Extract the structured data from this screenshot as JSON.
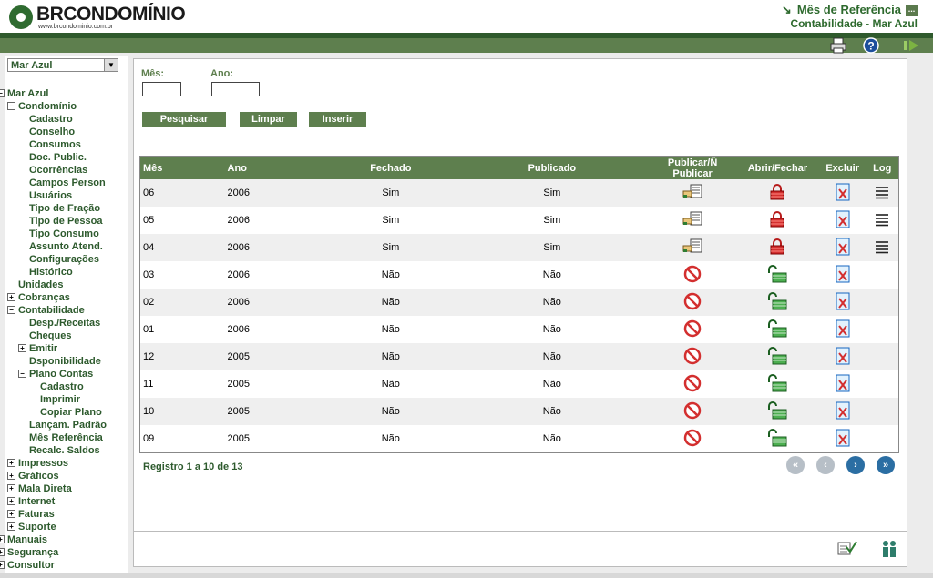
{
  "header": {
    "brand": "BRCONDOMÍNIO",
    "brand_url": "www.brcondominio.com.br",
    "page_title": "Mês de Referência",
    "page_subtitle": "Contabilidade - Mar Azul",
    "title_arrow": "↘",
    "dots": "..."
  },
  "toolbar": {
    "icons": [
      "print-icon",
      "help-icon",
      "exit-icon"
    ]
  },
  "sidebar": {
    "selected_unit": "Mar Azul",
    "tree": [
      {
        "label": "Mar Azul",
        "level": 0,
        "toggle": "−"
      },
      {
        "label": "Condomínio",
        "level": 1,
        "toggle": "−"
      },
      {
        "label": "Cadastro",
        "level": 2,
        "toggle": ""
      },
      {
        "label": "Conselho",
        "level": 2,
        "toggle": ""
      },
      {
        "label": "Consumos",
        "level": 2,
        "toggle": ""
      },
      {
        "label": "Doc. Public.",
        "level": 2,
        "toggle": ""
      },
      {
        "label": "Ocorrências",
        "level": 2,
        "toggle": ""
      },
      {
        "label": "Campos Person",
        "level": 2,
        "toggle": ""
      },
      {
        "label": "Usuários",
        "level": 2,
        "toggle": ""
      },
      {
        "label": "Tipo de Fração",
        "level": 2,
        "toggle": ""
      },
      {
        "label": "Tipo de Pessoa",
        "level": 2,
        "toggle": ""
      },
      {
        "label": "Tipo Consumo",
        "level": 2,
        "toggle": ""
      },
      {
        "label": "Assunto Atend.",
        "level": 2,
        "toggle": ""
      },
      {
        "label": "Configurações",
        "level": 2,
        "toggle": ""
      },
      {
        "label": "Histórico",
        "level": 2,
        "toggle": ""
      },
      {
        "label": "Unidades",
        "level": 1,
        "toggle": ""
      },
      {
        "label": "Cobranças",
        "level": 1,
        "toggle": "+"
      },
      {
        "label": "Contabilidade",
        "level": 1,
        "toggle": "−"
      },
      {
        "label": "Desp./Receitas",
        "level": 2,
        "toggle": ""
      },
      {
        "label": "Cheques",
        "level": 2,
        "toggle": ""
      },
      {
        "label": "Emitir",
        "level": 2,
        "toggle": "+"
      },
      {
        "label": "Dsponibilidade",
        "level": 2,
        "toggle": ""
      },
      {
        "label": "Plano Contas",
        "level": 2,
        "toggle": "−"
      },
      {
        "label": "Cadastro",
        "level": 3,
        "toggle": ""
      },
      {
        "label": "Imprimir",
        "level": 3,
        "toggle": ""
      },
      {
        "label": "Copiar Plano",
        "level": 3,
        "toggle": ""
      },
      {
        "label": "Lançam. Padrão",
        "level": 2,
        "toggle": ""
      },
      {
        "label": "Mês Referência",
        "level": 2,
        "toggle": ""
      },
      {
        "label": "Recalc. Saldos",
        "level": 2,
        "toggle": ""
      },
      {
        "label": "Impressos",
        "level": 1,
        "toggle": "+"
      },
      {
        "label": "Gráficos",
        "level": 1,
        "toggle": "+"
      },
      {
        "label": "Mala Direta",
        "level": 1,
        "toggle": "+"
      },
      {
        "label": "Internet",
        "level": 1,
        "toggle": "+"
      },
      {
        "label": "Faturas",
        "level": 1,
        "toggle": "+"
      },
      {
        "label": "Suporte",
        "level": 1,
        "toggle": "+"
      },
      {
        "label": "Manuais",
        "level": 0,
        "toggle": "+"
      },
      {
        "label": "Segurança",
        "level": 0,
        "toggle": "+"
      },
      {
        "label": "Consultor",
        "level": 0,
        "toggle": "+"
      }
    ]
  },
  "form": {
    "mes_label": "Mês:",
    "ano_label": "Ano:",
    "mes_value": "",
    "ano_value": "",
    "buttons": {
      "search": "Pesquisar",
      "clear": "Limpar",
      "insert": "Inserir"
    }
  },
  "table": {
    "headers": [
      "Mês",
      "Ano",
      "Fechado",
      "Publicado",
      "Publicar/Ñ Publicar",
      "Abrir/Fechar",
      "Excluir",
      "Log"
    ],
    "rows": [
      {
        "mes": "06",
        "ano": "2006",
        "fechado": "Sim",
        "publicado": "Sim",
        "pub_icon": "publish-hand-icon",
        "lock_icon": "closed-lock-icon",
        "log": true
      },
      {
        "mes": "05",
        "ano": "2006",
        "fechado": "Sim",
        "publicado": "Sim",
        "pub_icon": "publish-hand-icon",
        "lock_icon": "closed-lock-icon",
        "log": true
      },
      {
        "mes": "04",
        "ano": "2006",
        "fechado": "Sim",
        "publicado": "Sim",
        "pub_icon": "publish-hand-icon",
        "lock_icon": "closed-lock-icon",
        "log": true
      },
      {
        "mes": "03",
        "ano": "2006",
        "fechado": "Não",
        "publicado": "Não",
        "pub_icon": "no-entry-icon",
        "lock_icon": "open-lock-icon",
        "log": false
      },
      {
        "mes": "02",
        "ano": "2006",
        "fechado": "Não",
        "publicado": "Não",
        "pub_icon": "no-entry-icon",
        "lock_icon": "open-lock-icon",
        "log": false
      },
      {
        "mes": "01",
        "ano": "2006",
        "fechado": "Não",
        "publicado": "Não",
        "pub_icon": "no-entry-icon",
        "lock_icon": "open-lock-icon",
        "log": false
      },
      {
        "mes": "12",
        "ano": "2005",
        "fechado": "Não",
        "publicado": "Não",
        "pub_icon": "no-entry-icon",
        "lock_icon": "open-lock-icon",
        "log": false
      },
      {
        "mes": "11",
        "ano": "2005",
        "fechado": "Não",
        "publicado": "Não",
        "pub_icon": "no-entry-icon",
        "lock_icon": "open-lock-icon",
        "log": false
      },
      {
        "mes": "10",
        "ano": "2005",
        "fechado": "Não",
        "publicado": "Não",
        "pub_icon": "no-entry-icon",
        "lock_icon": "open-lock-icon",
        "log": false
      },
      {
        "mes": "09",
        "ano": "2005",
        "fechado": "Não",
        "publicado": "Não",
        "pub_icon": "no-entry-icon",
        "lock_icon": "open-lock-icon",
        "log": false
      }
    ]
  },
  "pagination": {
    "summary": "Registro 1 a 10 de 13",
    "first": "«",
    "prev": "‹",
    "next": "›",
    "last": "»"
  },
  "colors": {
    "accent": "#5e7f4e",
    "dark_green": "#2f5a2d",
    "text_green": "#2d5a2d",
    "pager_blue": "#2b6ea3"
  }
}
